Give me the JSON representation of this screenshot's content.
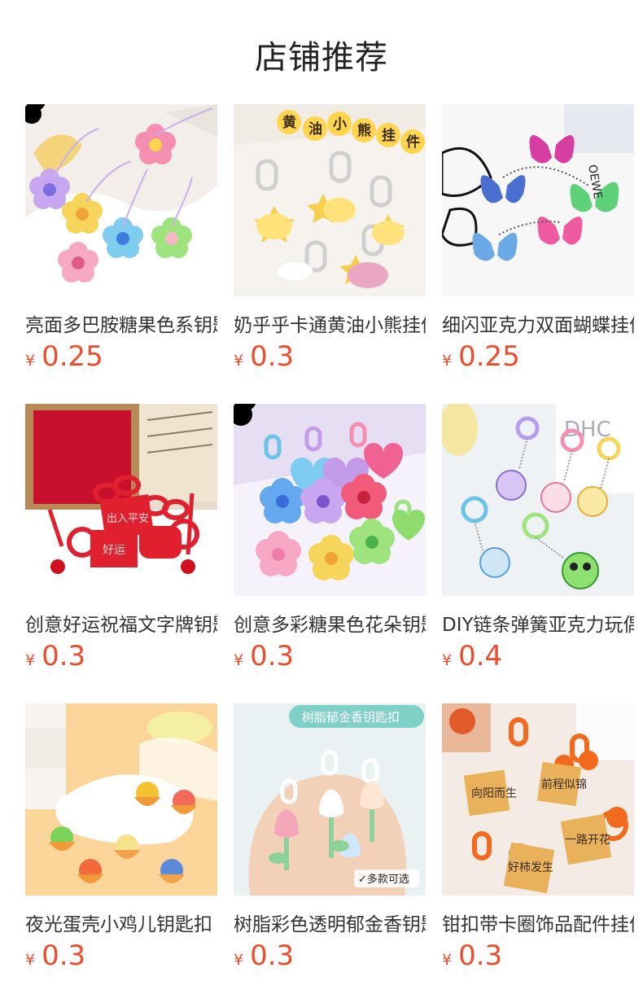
{
  "page": {
    "title": "店铺推荐"
  },
  "products": [
    {
      "name": "亮面多巴胺糖果色系钥匙扣",
      "currency": "¥",
      "price": "0.25",
      "image": "flower-keychains-image"
    },
    {
      "name": "奶乎乎卡通黄油小熊挂件",
      "currency": "¥",
      "price": "0.3",
      "image": "butter-bear-keychains-image"
    },
    {
      "name": "细闪亚克力双面蝴蝶挂件",
      "currency": "¥",
      "price": "0.25",
      "image": "butterfly-pendants-image"
    },
    {
      "name": "创意好运祝福文字牌钥匙扣",
      "currency": "¥",
      "price": "0.3",
      "image": "lucky-tag-keychains-image"
    },
    {
      "name": "创意多彩糖果色花朵钥匙扣",
      "currency": "¥",
      "price": "0.3",
      "image": "candy-flower-keychains-image"
    },
    {
      "name": "DIY链条弹簧亚克力玩偶挂件",
      "currency": "¥",
      "price": "0.4",
      "image": "acrylic-character-keychains-image"
    },
    {
      "name": "夜光蛋壳小鸡儿钥匙扣",
      "currency": "¥",
      "price": "0.3",
      "image": "eggshell-chick-keychains-image"
    },
    {
      "name": "树脂彩色透明郁金香钥匙扣",
      "currency": "¥",
      "price": "0.3",
      "image": "tulip-keychains-image"
    },
    {
      "name": "钳扣带卡圈饰品配件挂件",
      "currency": "¥",
      "price": "0.3",
      "image": "bell-tag-keychains-image"
    }
  ],
  "image_text": {
    "butter_bear_banner": [
      "黄",
      "油",
      "小",
      "熊",
      "挂",
      "件"
    ],
    "tulip_banner": "树脂郁金香钥匙扣",
    "tulip_badge": "✓多款可选",
    "bell_tags": [
      "向阳而生",
      "前程似锦",
      "一路开花",
      "好柿发生"
    ],
    "lucky_tags": [
      "出入平安",
      "好运"
    ]
  }
}
